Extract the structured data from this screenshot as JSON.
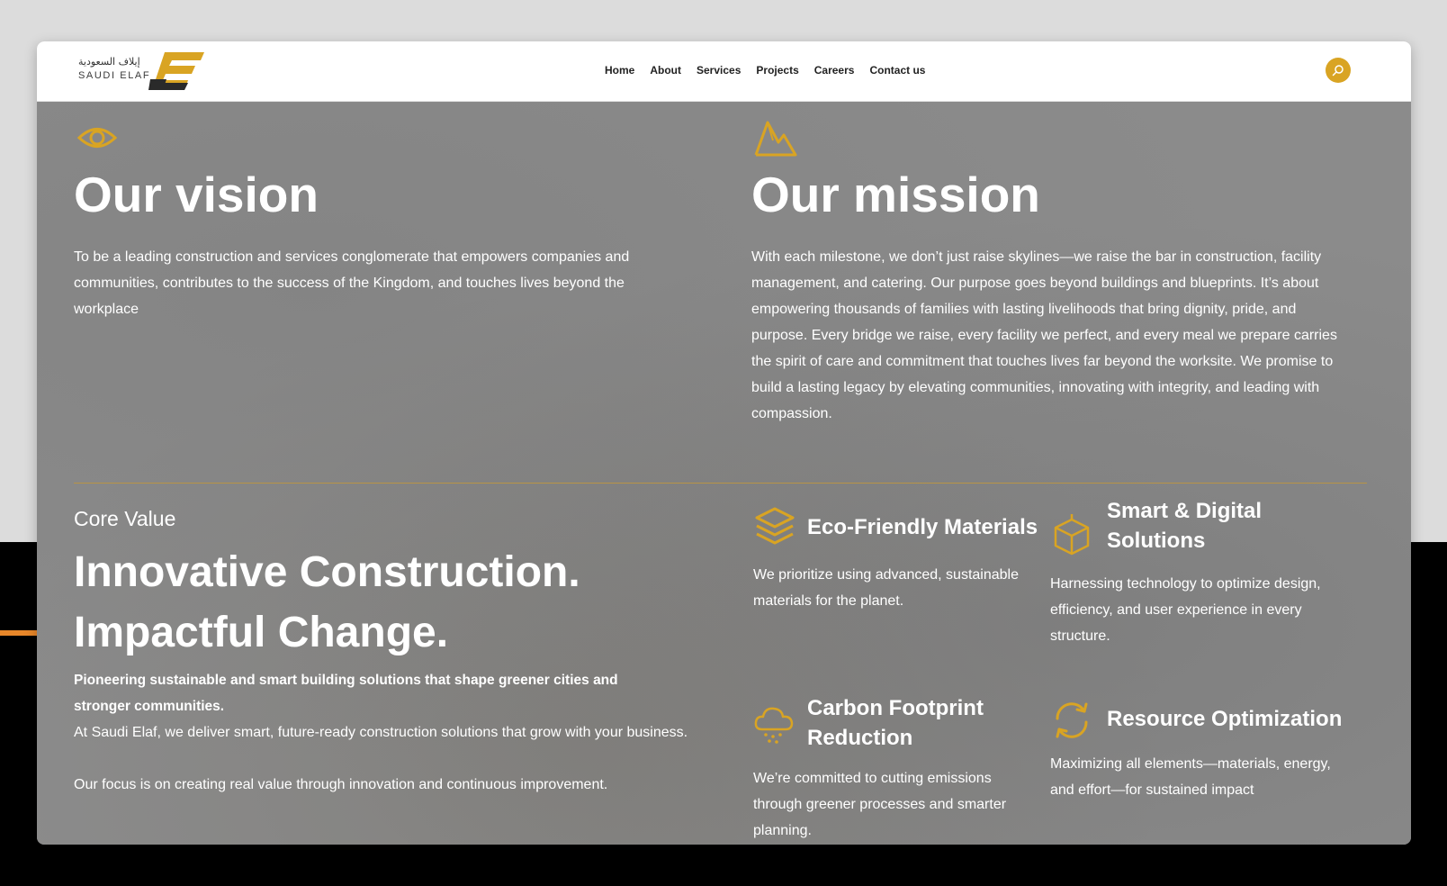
{
  "colors": {
    "accent": "#d9a423",
    "overlay": "#8b8b8b",
    "header_bg": "#ffffff",
    "divider": "#b89446"
  },
  "logo": {
    "arabic_text": "إيلاف السعودية",
    "latin_text": "SAUDI ELAF",
    "mark_icon": "elaf-e-logo-icon"
  },
  "nav": {
    "items": [
      {
        "label": "Home"
      },
      {
        "label": "About"
      },
      {
        "label": "Services"
      },
      {
        "label": "Projects"
      },
      {
        "label": "Careers"
      },
      {
        "label": "Contact us"
      }
    ],
    "search_icon": "search-icon"
  },
  "vision": {
    "icon": "eye-icon",
    "title": "Our vision",
    "text": "To be a leading construction and services conglomerate that empowers companies and communities, contributes to the success of the Kingdom, and touches lives beyond the workplace"
  },
  "mission": {
    "icon": "mountain-icon",
    "title": "Our mission",
    "text": "With each milestone, we don’t just raise skylines—we raise the bar in construction, facility management, and catering. Our purpose goes beyond buildings and blueprints. It’s about empowering thousands of families with lasting livelihoods that bring dignity, pride, and purpose. Every bridge we raise, every facility we perfect, and every meal we prepare carries the spirit of care and commitment that touches lives far beyond the worksite. We promise to build a lasting legacy by elevating communities, innovating with integrity, and leading with compassion."
  },
  "core": {
    "eyebrow": "Core Value",
    "title_line1": "Innovative Construction.",
    "title_line2": "Impactful Change.",
    "lead": "Pioneering sustainable and smart building solutions that shape greener cities and stronger communities.",
    "p1": "At Saudi Elaf, we deliver smart, future-ready construction solutions that grow with your business.",
    "p2": "Our focus is on creating real value through innovation and continuous improvement."
  },
  "features": [
    {
      "icon": "layers-icon",
      "title": "Eco-Friendly Materials",
      "text": "We prioritize using advanced, sustainable materials for the planet."
    },
    {
      "icon": "cube-icon",
      "title": "Smart & Digital Solutions",
      "text": "Harnessing technology to optimize design, efficiency, and user experience in every structure."
    },
    {
      "icon": "cloud-icon",
      "title": "Carbon Footprint Reduction",
      "text": "We’re committed to cutting emissions through greener processes and smarter planning."
    },
    {
      "icon": "refresh-icon",
      "title": "Resource Optimization",
      "text": "Maximizing all elements—materials, energy, and effort—for sustained impact"
    }
  ]
}
